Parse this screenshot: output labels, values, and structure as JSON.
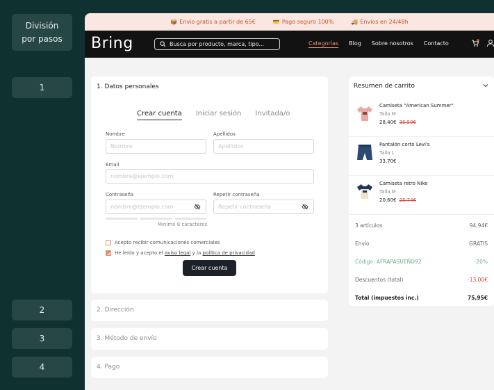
{
  "rail": {
    "title": "División por pasos",
    "steps": [
      "1",
      "2",
      "3",
      "4"
    ]
  },
  "promo": {
    "items": [
      "Envío gratis a partir de 65€",
      "Pago seguro 100%",
      "Envíos en 24/48h"
    ],
    "icons": [
      "package-icon",
      "credit-card-icon",
      "truck-icon"
    ]
  },
  "nav": {
    "logo": "Bring",
    "search_placeholder": "Busca por producto, marca, tipo...",
    "links": [
      "Categorías",
      "Blog",
      "Sobre nosotros",
      "Contacto"
    ],
    "active_link": "Categorías"
  },
  "checkout": {
    "step1": {
      "title": "1. Datos personales",
      "tabs": [
        "Crear cuenta",
        "Iniciar sesión",
        "Invitada/o"
      ],
      "active_tab": "Crear cuenta",
      "fields": {
        "nombre_label": "Nombre",
        "nombre_placeholder": "Nombre",
        "apellidos_label": "Apellidos",
        "apellidos_placeholder": "Apellidos",
        "email_label": "Email",
        "email_placeholder": "nombre@ejemplo.com",
        "password_label": "Contraseña",
        "password_placeholder": "nombre@ejemplo.com",
        "repeat_label": "Repetir contraseña",
        "repeat_placeholder": "Repetir contraseña"
      },
      "password_hint": "Mínimo 8 caracteres",
      "checkbox_news": "Acepto recibir comunicaciones comerciales",
      "checkbox_legal_pre": "He leído y acepto el",
      "checkbox_legal_link1": "aviso legal",
      "checkbox_legal_mid": "y la",
      "checkbox_legal_link2": "política de privacidad",
      "news_checked": false,
      "legal_checked": true,
      "submit": "Crear cuenta"
    },
    "step2": "2. Dirección",
    "step3": "3. Método de envío",
    "step4": "4. Pago"
  },
  "summary": {
    "title": "Resumen de carrito",
    "products": [
      {
        "name": "Camiseta \"American Summer\"",
        "size": "Talla M",
        "price": "28,40€",
        "old_price": "35,50€",
        "icon": "tshirt-pink-icon"
      },
      {
        "name": "Pantalón corto Levi's",
        "size": "Talla L",
        "price": "33,70€",
        "old_price": "",
        "icon": "denim-shorts-icon"
      },
      {
        "name": "Camiseta retro Nike",
        "size": "Talla M",
        "price": "20,60€",
        "old_price": "25,74€",
        "icon": "tshirt-retro-icon"
      }
    ],
    "rows": {
      "items_label": "3 artículos",
      "items_value": "94,94€",
      "shipping_label": "Envío",
      "shipping_value": "GRATIS",
      "code_label": "Código: AFRAPASUEÑO92",
      "code_value": "-20%",
      "discount_label": "Descuentos (total)",
      "discount_value": "-13,00€",
      "total_label": "Total (impuestos inc.)",
      "total_value": "75,95€"
    }
  },
  "colors": {
    "background": "#0f3130",
    "accent": "#e0906c",
    "sale": "#d6453c",
    "code_green": "#6fae8d",
    "nav": "#121212"
  }
}
